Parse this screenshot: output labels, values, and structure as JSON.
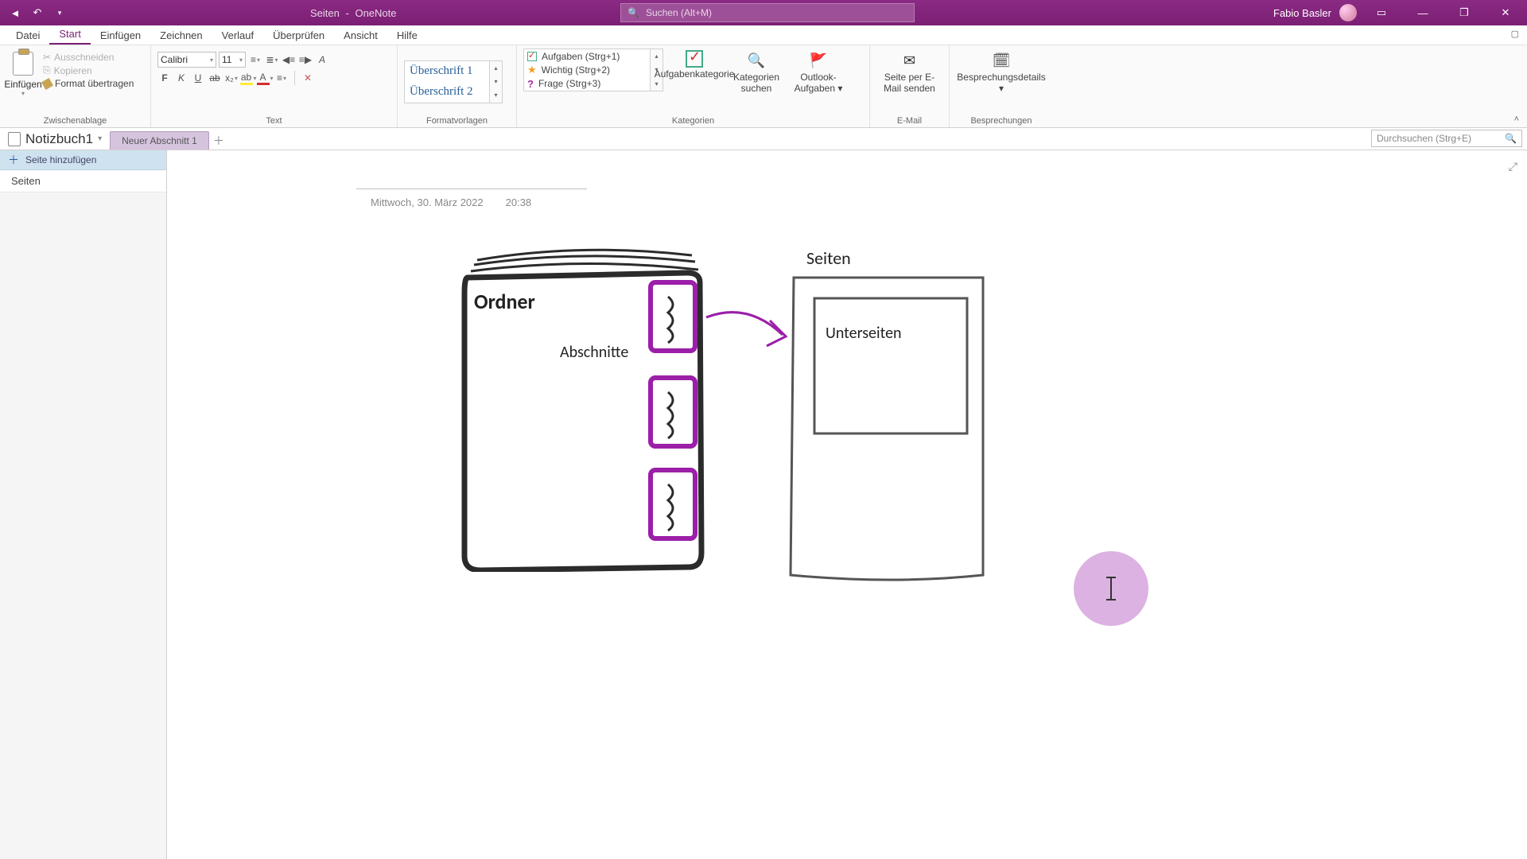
{
  "titlebar": {
    "page_title": "Seiten",
    "app_name": "OneNote",
    "search_placeholder": "Suchen (Alt+M)",
    "user_name": "Fabio Basler"
  },
  "menu": {
    "items": [
      "Datei",
      "Start",
      "Einfügen",
      "Zeichnen",
      "Verlauf",
      "Überprüfen",
      "Ansicht",
      "Hilfe"
    ],
    "active_index": 1
  },
  "ribbon": {
    "clipboard": {
      "paste": "Einfügen",
      "cut": "Ausschneiden",
      "copy": "Kopieren",
      "format_painter": "Format übertragen",
      "group_label": "Zwischenablage"
    },
    "text": {
      "font_name": "Calibri",
      "font_size": "11",
      "group_label": "Text"
    },
    "styles": {
      "heading1": "Überschrift 1",
      "heading2": "Überschrift 2",
      "group_label": "Formatvorlagen"
    },
    "tags": {
      "items": [
        {
          "label": "Aufgaben (Strg+1)"
        },
        {
          "label": "Wichtig (Strg+2)"
        },
        {
          "label": "Frage (Strg+3)"
        }
      ],
      "task_category": "Aufgabenkategorie",
      "find_tags": "Kategorien suchen",
      "outlook_tasks": "Outlook-Aufgaben",
      "group_label": "Kategorien"
    },
    "email": {
      "send_page": "Seite per E-Mail senden",
      "group_label": "E-Mail"
    },
    "meetings": {
      "details": "Besprechungsdetails",
      "group_label": "Besprechungen"
    }
  },
  "notebook": {
    "name": "Notizbuch1",
    "section_tab": "Neuer Abschnitt 1",
    "search_placeholder": "Durchsuchen (Strg+E)"
  },
  "pages_panel": {
    "add_page": "Seite hinzufügen",
    "pages": [
      "Seiten"
    ]
  },
  "page_content": {
    "date": "Mittwoch, 30. März 2022",
    "time": "20:38",
    "labels": {
      "ordner": "Ordner",
      "abschnitte": "Abschnitte",
      "seiten": "Seiten",
      "unterseiten": "Unterseiten"
    }
  }
}
